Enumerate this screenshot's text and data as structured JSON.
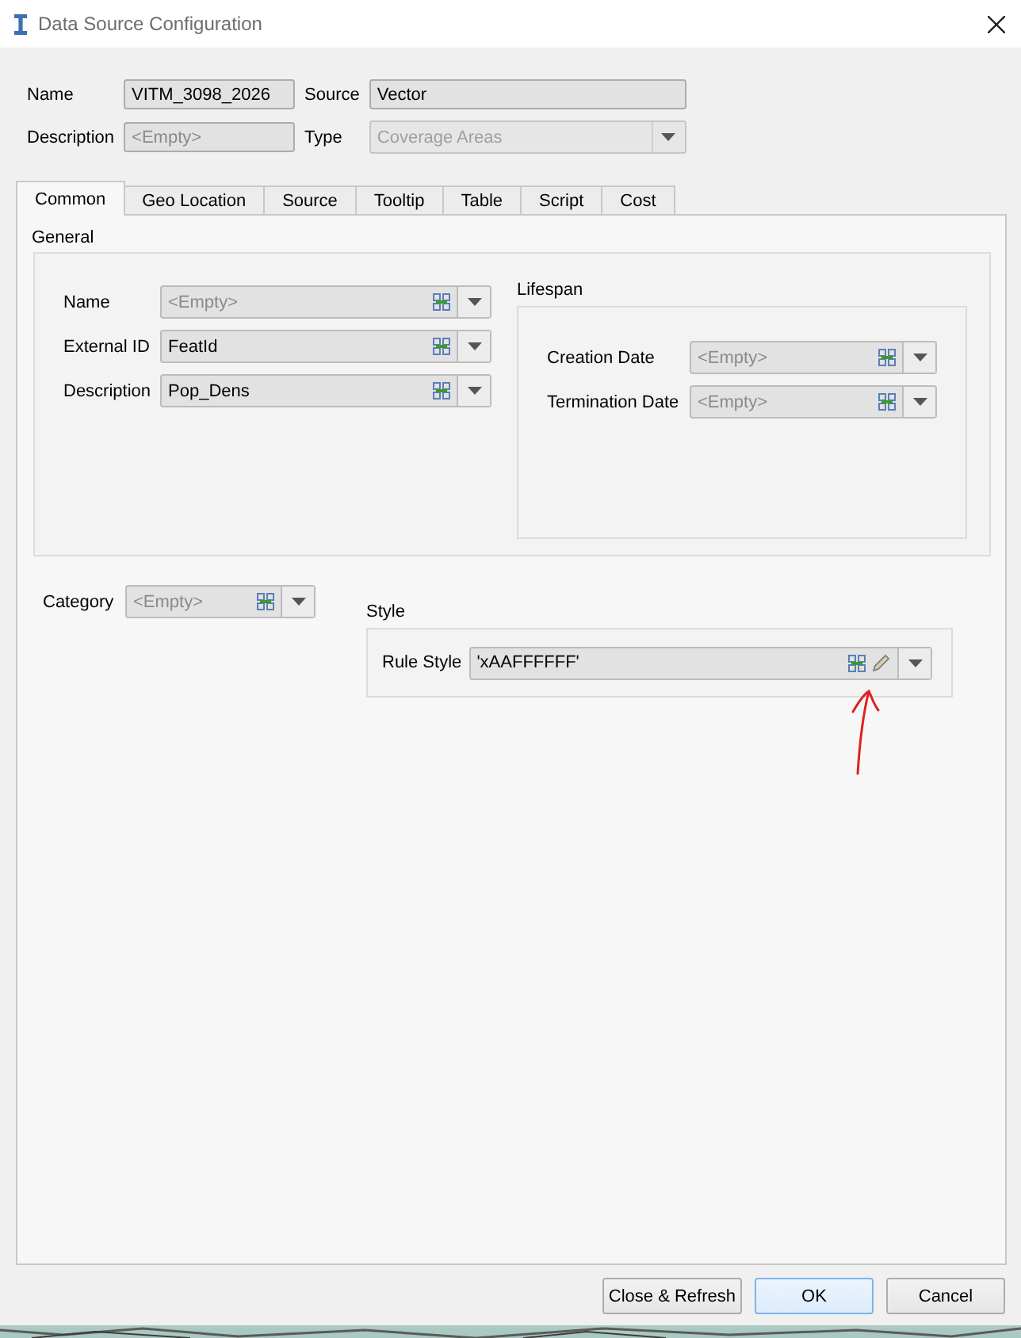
{
  "window": {
    "title": "Data Source Configuration"
  },
  "header": {
    "name": {
      "label": "Name",
      "value": "VITM_3098_2026"
    },
    "source": {
      "label": "Source",
      "value": "Vector"
    },
    "description": {
      "label": "Description",
      "placeholder": "<Empty>"
    },
    "type": {
      "label": "Type",
      "value": "Coverage Areas",
      "disabled": true
    }
  },
  "tabs": [
    {
      "label": "Common",
      "selected": true
    },
    {
      "label": "Geo Location",
      "selected": false
    },
    {
      "label": "Source",
      "selected": false
    },
    {
      "label": "Tooltip",
      "selected": false
    },
    {
      "label": "Table",
      "selected": false
    },
    {
      "label": "Script",
      "selected": false
    },
    {
      "label": "Cost",
      "selected": false
    }
  ],
  "general": {
    "title": "General",
    "fields": [
      {
        "label": "Name",
        "placeholder": "<Empty>"
      },
      {
        "label": "External ID",
        "value": "FeatId"
      },
      {
        "label": "Description",
        "value": "Pop_Dens"
      }
    ],
    "lifespan": {
      "title": "Lifespan",
      "fields": [
        {
          "label": "Creation Date",
          "placeholder": "<Empty>"
        },
        {
          "label": "Termination Date",
          "placeholder": "<Empty>"
        }
      ]
    }
  },
  "category": {
    "label": "Category",
    "placeholder": "<Empty>"
  },
  "style": {
    "title": "Style",
    "field": {
      "label": "Rule Style",
      "value": "'xAAFFFFFF'",
      "editable": true
    }
  },
  "buttons": [
    {
      "label": "Close & Refresh",
      "default": false
    },
    {
      "label": "OK",
      "default": true
    },
    {
      "label": "Cancel",
      "default": false
    }
  ]
}
